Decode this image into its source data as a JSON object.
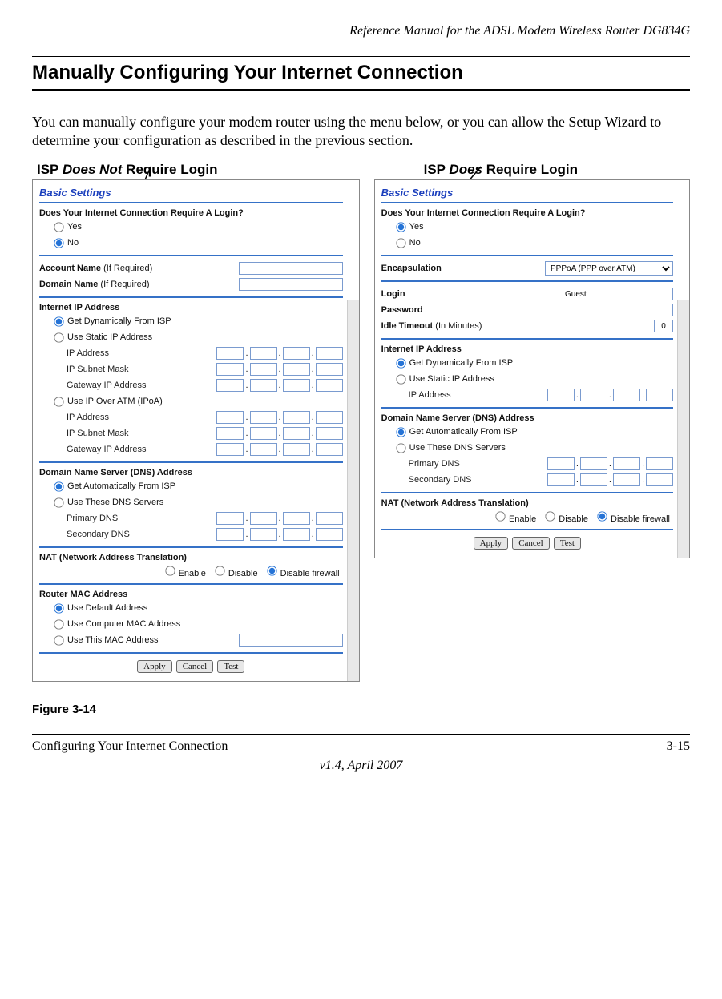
{
  "header": {
    "doc_title": "Reference Manual for the ADSL Modem Wireless Router DG834G"
  },
  "section_title": "Manually Configuring Your Internet Connection",
  "body_text": "You can manually configure your modem router using the menu below, or you can allow the Setup Wizard to determine your configuration as described in the previous section.",
  "callouts": {
    "left_prefix": "ISP ",
    "left_em": "Does Not",
    "left_suffix": " Require Login",
    "right_prefix": "ISP ",
    "right_em": "Does",
    "right_suffix": " Require Login"
  },
  "panel_title": "Basic Settings",
  "panel_left": {
    "question": "Does Your Internet Connection Require A Login?",
    "yes": "Yes",
    "no": "No",
    "selected": "no",
    "account_name": "Account Name",
    "domain_name": "Domain Name",
    "if_required": "(If Required)",
    "internet_ip": "Internet IP Address",
    "get_dyn": "Get Dynamically From ISP",
    "use_static": "Use Static IP Address",
    "ip_address": "IP Address",
    "ip_subnet": "IP Subnet Mask",
    "gateway_ip": "Gateway IP Address",
    "use_ipoa": "Use IP Over ATM (IPoA)",
    "dns_head": "Domain Name Server (DNS) Address",
    "dns_auto": "Get Automatically From ISP",
    "dns_use": "Use These DNS Servers",
    "primary_dns": "Primary DNS",
    "secondary_dns": "Secondary DNS",
    "nat_head": "NAT (Network Address Translation)",
    "nat_enable": "Enable",
    "nat_disable": "Disable",
    "nat_disable_fw": "Disable firewall",
    "mac_head": "Router MAC Address",
    "mac_default": "Use Default Address",
    "mac_computer": "Use Computer MAC Address",
    "mac_this": "Use This MAC Address"
  },
  "panel_right": {
    "question": "Does Your Internet Connection Require A Login?",
    "yes": "Yes",
    "no": "No",
    "selected": "yes",
    "encapsulation": "Encapsulation",
    "enc_value": "PPPoA (PPP over ATM)",
    "login": "Login",
    "login_value": "Guest",
    "password": "Password",
    "idle_timeout": "Idle Timeout",
    "idle_note": "(In Minutes)",
    "idle_value": "0",
    "internet_ip": "Internet IP Address",
    "get_dyn": "Get Dynamically From ISP",
    "use_static": "Use Static IP Address",
    "ip_address": "IP Address",
    "dns_head": "Domain Name Server (DNS) Address",
    "dns_auto": "Get Automatically From ISP",
    "dns_use": "Use These DNS Servers",
    "primary_dns": "Primary DNS",
    "secondary_dns": "Secondary DNS",
    "nat_head": "NAT (Network Address Translation)",
    "nat_enable": "Enable",
    "nat_disable": "Disable",
    "nat_disable_fw": "Disable firewall"
  },
  "buttons": {
    "apply": "Apply",
    "cancel": "Cancel",
    "test": "Test"
  },
  "figure_caption": "Figure 3-14",
  "footer": {
    "left": "Configuring Your Internet Connection",
    "right": "3-15",
    "center": "v1.4, April 2007"
  }
}
